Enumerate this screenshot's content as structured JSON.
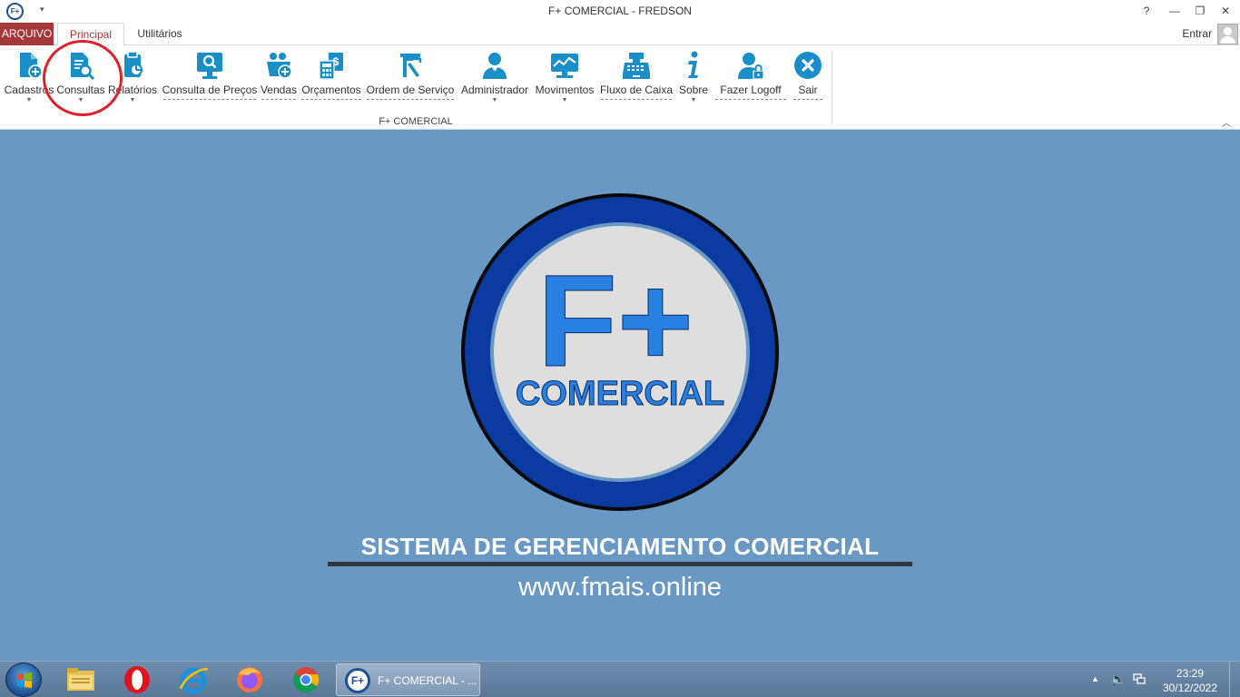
{
  "window": {
    "title": "F+ COMERCIAL - FREDSON",
    "app_icon_text": "F+",
    "help": "?",
    "minimize": "—",
    "restore": "❐",
    "close": "✕"
  },
  "tabs": {
    "arquivo": "ARQUIVO",
    "principal": "Principal",
    "utilitarios": "Utilitários",
    "entrar": "Entrar"
  },
  "ribbon": {
    "buttons": [
      {
        "label": "Cadastros",
        "icon": "document-add-icon",
        "dropdown": true
      },
      {
        "label": "Consultas",
        "icon": "document-search-icon",
        "dropdown": true
      },
      {
        "label": "Relatórios",
        "icon": "report-icon",
        "dropdown": true
      },
      {
        "label": "Consulta de Preços",
        "icon": "monitor-search-icon",
        "shortcut": true
      },
      {
        "label": "Vendas",
        "icon": "basket-add-icon",
        "shortcut": true
      },
      {
        "label": "Orçamentos",
        "icon": "calculator-icon",
        "shortcut": true
      },
      {
        "label": "Ordem de Serviço",
        "icon": "tools-icon",
        "shortcut": true
      },
      {
        "label": "Administrador",
        "icon": "user-admin-icon",
        "dropdown": true
      },
      {
        "label": "Movimentos",
        "icon": "monitor-chart-icon",
        "dropdown": true
      },
      {
        "label": "Fluxo de Caixa",
        "icon": "cash-register-icon",
        "shortcut": true
      },
      {
        "label": "Sobre",
        "icon": "info-icon",
        "dropdown": true
      },
      {
        "label": "Fazer Logoff",
        "icon": "user-lock-icon",
        "shortcut": true
      },
      {
        "label": "Sair",
        "icon": "close-circle-icon",
        "shortcut": true
      }
    ],
    "group_label": "F+ COMERCIAL",
    "highlighted": "Consultas"
  },
  "main": {
    "logo_top": "F+",
    "logo_bottom": "COMERCIAL",
    "tagline": "SISTEMA DE GERENCIAMENTO COMERCIAL",
    "website": "www.fmais.online"
  },
  "taskbar": {
    "pinned": [
      "file-explorer-icon",
      "opera-icon",
      "internet-explorer-icon",
      "firefox-icon",
      "chrome-icon"
    ],
    "active_task": "F+ COMERCIAL - ...",
    "active_task_icon_text": "F+",
    "time": "23:29",
    "date": "30/12/2022"
  },
  "colors": {
    "accent_red": "#a4373a",
    "icon_blue": "#1a8fc7",
    "background_blue": "#6a98c4",
    "logo_dark_blue": "#0b3aa0",
    "logo_letter_blue": "#2880e0"
  }
}
